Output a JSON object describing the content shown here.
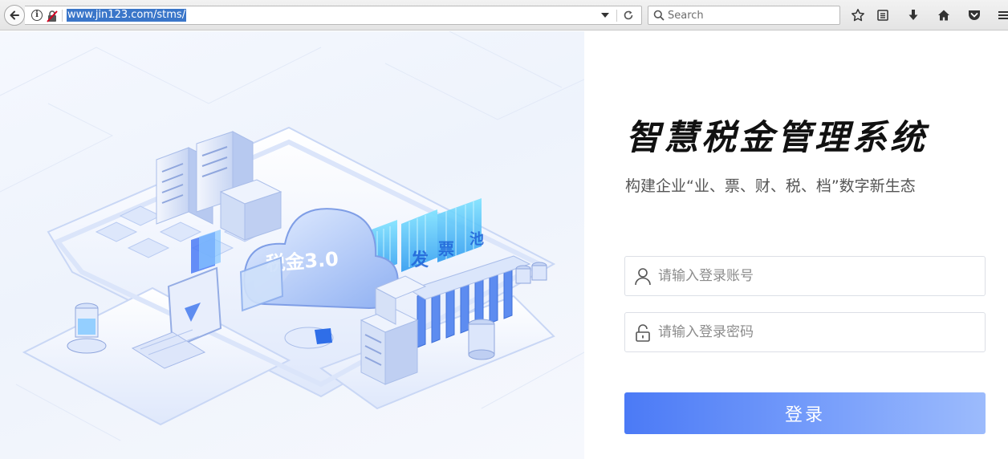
{
  "browser": {
    "url": "www.jin123.com/stms/",
    "search_placeholder": "Search",
    "icons": [
      "back-arrow-icon",
      "info-icon",
      "insecure-lock-icon",
      "dropdown-icon",
      "reload-icon",
      "search-icon",
      "star-icon",
      "reading-list-icon",
      "download-icon",
      "home-icon",
      "pocket-icon",
      "menu-icon"
    ]
  },
  "hero": {
    "cloud_text": "税金3.0",
    "tile_text": [
      "发",
      "票",
      "池"
    ],
    "accent_color": "#4b7af6"
  },
  "login": {
    "title": "智慧税金管理系统",
    "subtitle": "构建企业“业、票、财、税、档”数字新生态",
    "username_placeholder": "请输入登录账号",
    "password_placeholder": "请输入登录密码",
    "submit_label": "登录",
    "button_color_start": "#4b7af6",
    "button_color_end": "#9cbbfc"
  }
}
